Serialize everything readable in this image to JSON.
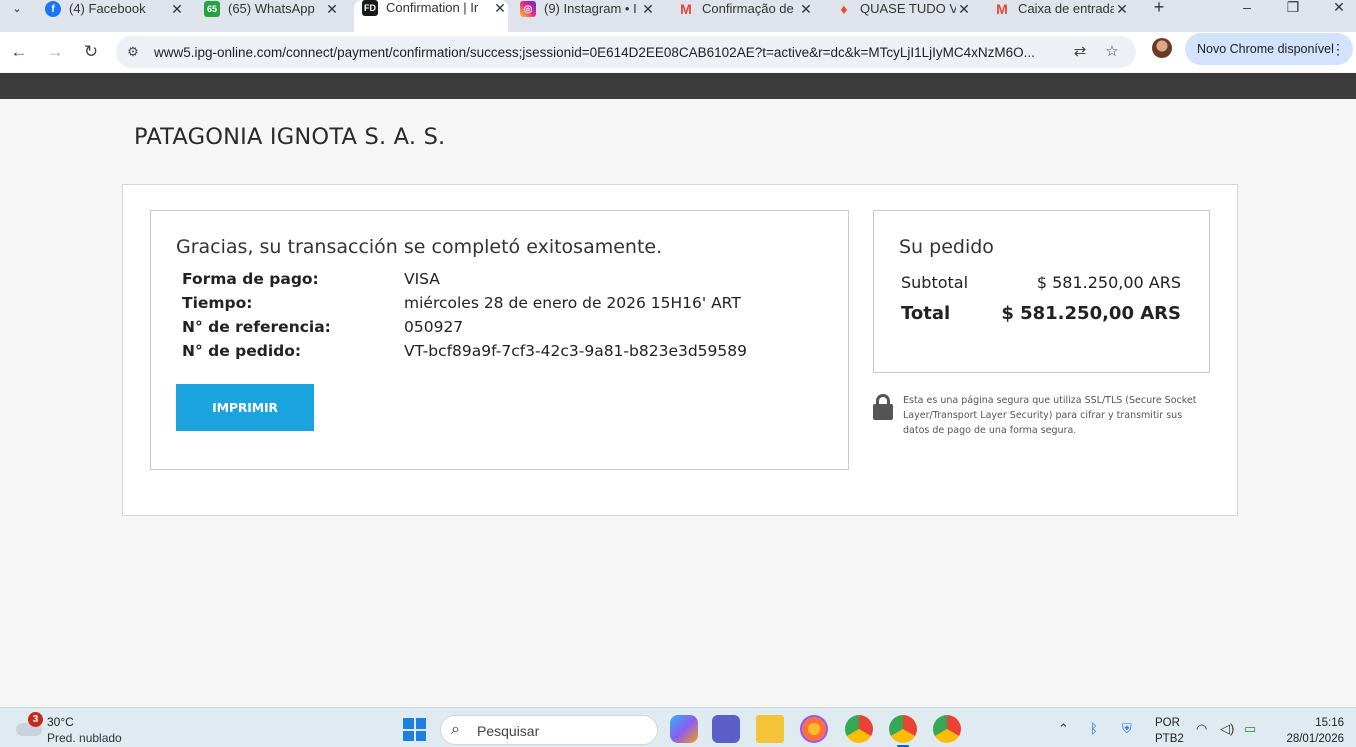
{
  "browser": {
    "tabs": [
      {
        "title": "(4) Facebook",
        "icon": "facebook-icon",
        "color": "#1877f2",
        "glyph": "f"
      },
      {
        "title": "(65) WhatsApp",
        "icon": "whatsapp-icon",
        "color": "#25d366",
        "glyph": "65"
      },
      {
        "title": "Confirmation | Ir",
        "icon": "fiserv-icon",
        "color": "#1a1a1a",
        "glyph": "FD"
      },
      {
        "title": "(9) Instagram • I",
        "icon": "instagram-icon",
        "color": "#d6249f",
        "glyph": "◎"
      },
      {
        "title": "Confirmação de",
        "icon": "gmail-icon",
        "color": "#ea4335",
        "glyph": "M"
      },
      {
        "title": "QUASE TUDO VI",
        "icon": "flame-icon",
        "color": "#e8501e",
        "glyph": "♦"
      },
      {
        "title": "Caixa de entrada",
        "icon": "gmail-icon",
        "color": "#ea4335",
        "glyph": "M"
      }
    ],
    "close_glyph": "✕",
    "new_tab_glyph": "+",
    "url": "www5.ipg-online.com/connect/payment/confirmation/success;jsessionid=0E614D2EE08CAB6102AE?t=active&r=dc&k=MTcyLjI1LjIyMC4xNzM6O...",
    "update_label": "Novo Chrome disponível"
  },
  "page": {
    "merchant_name": "PATAGONIA IGNOTA S. A. S.",
    "transaction": {
      "title": "Gracias, su transacción se completó exitosamente.",
      "rows": [
        {
          "label": "Forma de pago:",
          "value": "VISA"
        },
        {
          "label": "Tiempo:",
          "value": "miércoles 28 de enero de 2026 15H16' ART"
        },
        {
          "label": "N° de referencia:",
          "value": "050927"
        },
        {
          "label": "N° de pedido:",
          "value": "VT-bcf89a9f-7cf3-42c3-9a81-b823e3d59589"
        }
      ],
      "print_label": "IMPRIMIR",
      "accent_color": "#1aa3dd"
    },
    "order": {
      "title": "Su pedido",
      "subtotal_label": "Subtotal",
      "subtotal_value": "$ 581.250,00 ARS",
      "total_label": "Total",
      "total_value": "$ 581.250,00 ARS"
    },
    "security_note": "Esta es una página segura que utiliza SSL/TLS (Secure Socket Layer/Transport Layer Security) para cifrar y transmitir sus datos de pago de una forma segura."
  },
  "taskbar": {
    "weather_badge": "3",
    "weather_temp": "30°C",
    "weather_desc": "Pred. nublado",
    "search_placeholder": "Pesquisar",
    "lang_top": "POR",
    "lang_bottom": "PTB2",
    "time": "15:16",
    "date": "28/01/2026"
  }
}
